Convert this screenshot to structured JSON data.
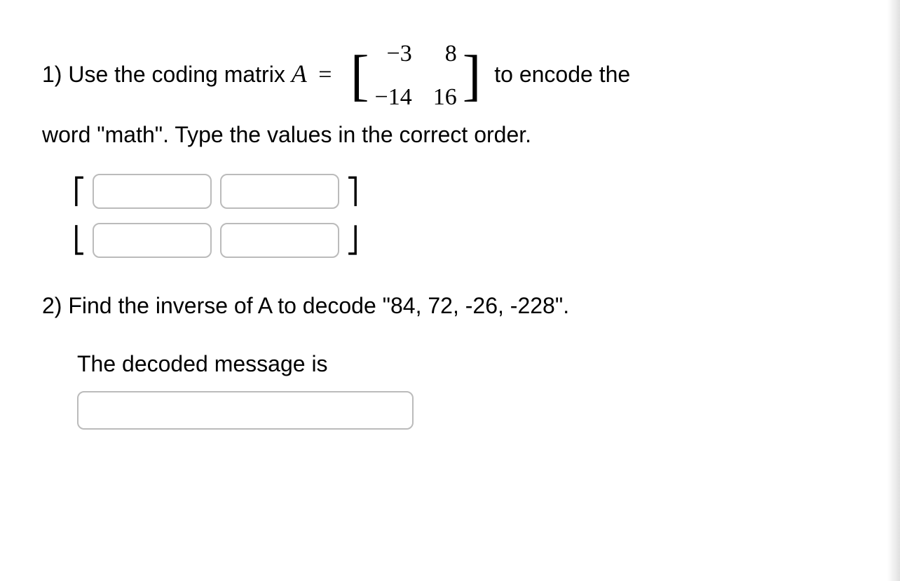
{
  "q1": {
    "prefix": "1) Use the coding matrix ",
    "var": "A",
    "equals": " = ",
    "matrix": {
      "r0c0": "−3",
      "r0c1": "8",
      "r1c0": "−14",
      "r1c1": "16"
    },
    "mid": " to encode the",
    "line2": "word \"math\". Type the values in the correct order."
  },
  "brackets": {
    "top_left": "⎡",
    "top_right": "⎤",
    "bot_left": "⎣",
    "bot_right": "⎦"
  },
  "q2": {
    "text": "2)  Find the inverse of A to decode \"84, 72, -26, -228\".",
    "label": "The decoded message is"
  }
}
